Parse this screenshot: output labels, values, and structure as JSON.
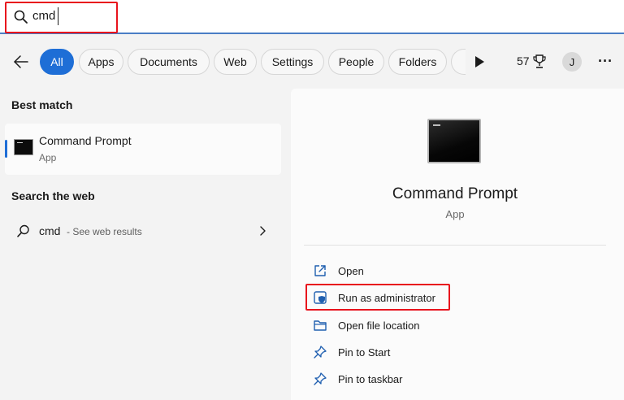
{
  "search": {
    "query": "cmd"
  },
  "filters": {
    "tabs": [
      {
        "label": "All",
        "active": true
      },
      {
        "label": "Apps"
      },
      {
        "label": "Documents"
      },
      {
        "label": "Web"
      },
      {
        "label": "Settings"
      },
      {
        "label": "People"
      },
      {
        "label": "Folders"
      }
    ],
    "points": "57",
    "avatar_initial": "J"
  },
  "left": {
    "best_match_heading": "Best match",
    "best_match": {
      "title": "Command Prompt",
      "subtitle": "App",
      "icon": "command-prompt-icon"
    },
    "web_heading": "Search the web",
    "web_result": {
      "query": "cmd",
      "suffix": "- See web results"
    }
  },
  "detail": {
    "title": "Command Prompt",
    "subtitle": "App",
    "actions": [
      {
        "label": "Open",
        "icon": "open-icon"
      },
      {
        "label": "Run as administrator",
        "icon": "shield-icon"
      },
      {
        "label": "Open file location",
        "icon": "folder-icon"
      },
      {
        "label": "Pin to Start",
        "icon": "pin-icon"
      },
      {
        "label": "Pin to taskbar",
        "icon": "pin-icon"
      }
    ]
  },
  "colors": {
    "accent": "#1e6ed6",
    "highlight_box": "#e8131d",
    "action_icon": "#1f5fb0"
  }
}
